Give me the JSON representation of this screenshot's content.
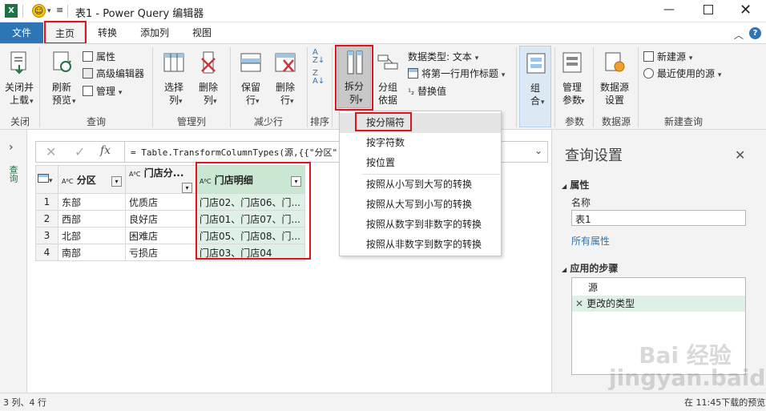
{
  "title": "表1 - Power Query 编辑器",
  "tabs": [
    "文件",
    "主页",
    "转换",
    "添加列",
    "视图"
  ],
  "ribbon": {
    "close_apply": "关闭并\n上载",
    "refresh": "刷新\n预览",
    "properties": "属性",
    "advanced_editor": "高级编辑器",
    "manage": "管理",
    "choose_cols": "选择\n列",
    "remove_cols": "删除\n列",
    "keep_rows": "保留\n行",
    "remove_rows": "删除\n行",
    "split_col": "拆分\n列",
    "group_by": "分组\n依据",
    "data_type": "数据类型: 文本",
    "first_row_header": "将第一行用作标题",
    "replace_values": "替换值",
    "combine": "组\n合",
    "manage_params": "管理\n参数",
    "datasource_settings": "数据源\n设置",
    "new_source": "新建源",
    "recent_sources": "最近使用的源",
    "groups": [
      "关闭",
      "查询",
      "管理列",
      "减少行",
      "排序",
      "参数",
      "数据源",
      "新建查询"
    ]
  },
  "formula": "= Table.TransformColumnTypes(源,{{\"分区\"",
  "left_label": "查询",
  "table": {
    "headers": [
      "分区",
      "门店分...",
      "门店明细"
    ],
    "rows": [
      [
        "1",
        "东部",
        "优质店",
        "门店02、门店06、门..."
      ],
      [
        "2",
        "西部",
        "良好店",
        "门店01、门店07、门..."
      ],
      [
        "3",
        "北部",
        "困难店",
        "门店05、门店08、门..."
      ],
      [
        "4",
        "南部",
        "亏损店",
        "门店03、门店04"
      ]
    ]
  },
  "menu": [
    "按分隔符",
    "按字符数",
    "按位置",
    "按照从小写到大写的转换",
    "按照从大写到小写的转换",
    "按照从数字到非数字的转换",
    "按照从非数字到数字的转换"
  ],
  "settings": {
    "title": "查询设置",
    "properties": "属性",
    "name_label": "名称",
    "name_value": "表1",
    "all_properties": "所有属性",
    "applied_steps": "应用的步骤",
    "steps": [
      "源",
      "更改的类型"
    ]
  },
  "status": {
    "left": "3 列、4 行",
    "right": "在 11:45下载的预览"
  },
  "watermark": "Bai 经验\njingyan.baidu.com",
  "colors": {
    "accent": "#2e75b6",
    "highlight": "#e0141e",
    "selected_col": "#dff0e6"
  }
}
